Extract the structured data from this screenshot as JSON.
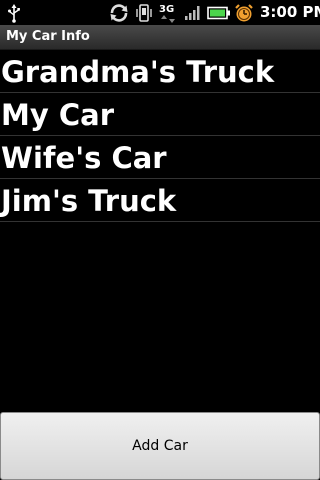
{
  "status_bar": {
    "time": "3:00 PM",
    "network_type": "3G",
    "icons": [
      "usb-icon",
      "sync-icon",
      "vibrate-icon",
      "network-3g-icon",
      "signal-icon",
      "battery-icon",
      "alarm-icon"
    ],
    "colors": {
      "battery": "#4cd44c",
      "alarm": "#f0a030"
    }
  },
  "app": {
    "title": "My Car Info"
  },
  "cars": {
    "items": [
      {
        "label": "Grandma's Truck"
      },
      {
        "label": "My Car"
      },
      {
        "label": "Wife's Car"
      },
      {
        "label": "Jim's Truck"
      }
    ]
  },
  "actions": {
    "add_car_label": "Add Car"
  }
}
